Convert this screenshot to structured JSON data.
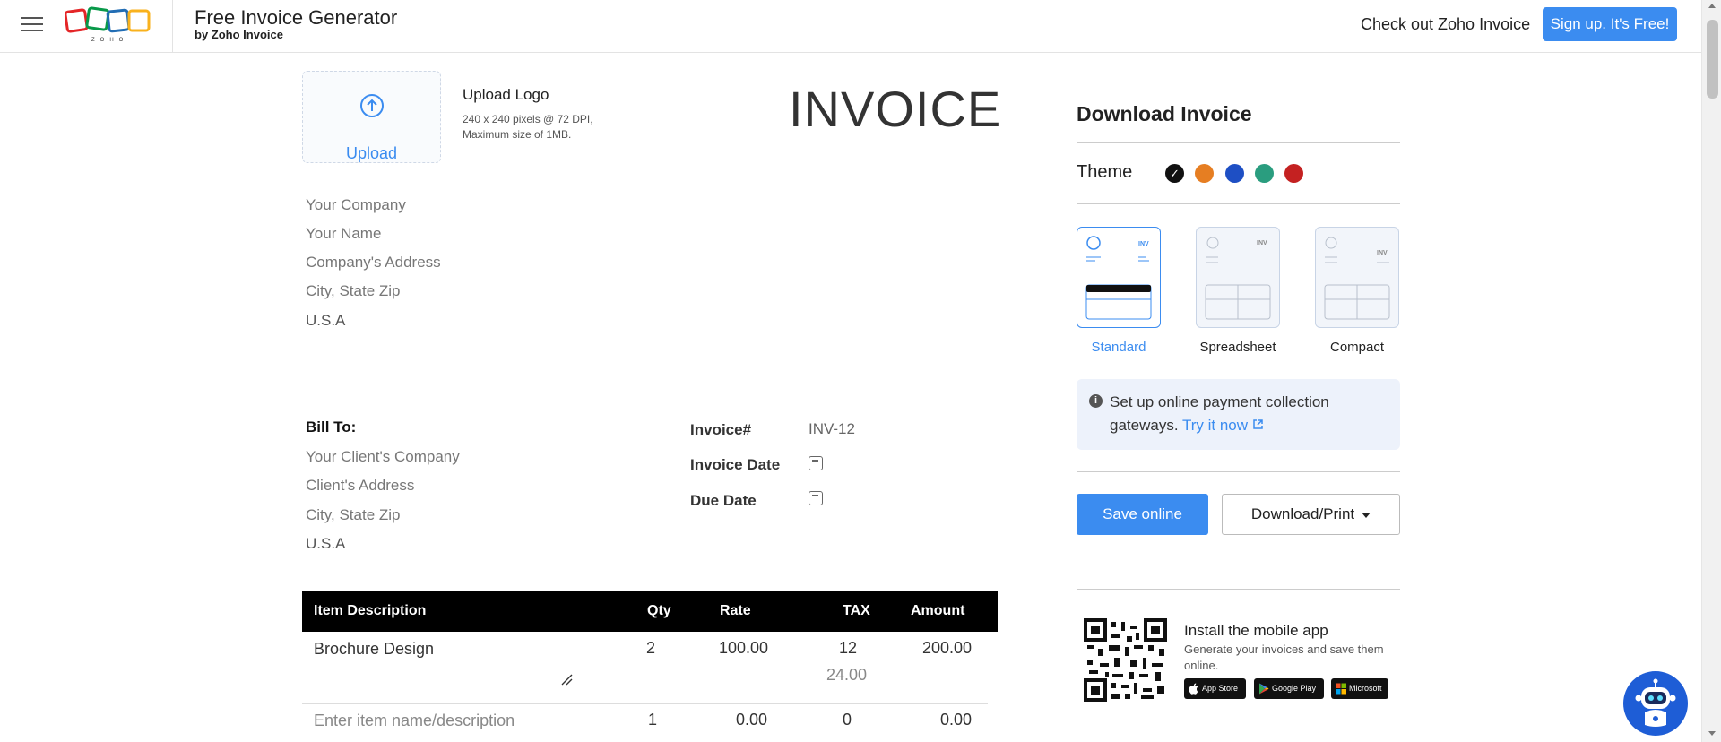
{
  "header": {
    "title": "Free Invoice Generator",
    "subtitle": "by Zoho Invoice",
    "cta_text": "Check out Zoho Invoice",
    "signup_label": "Sign up. It's Free!",
    "logo_text": "ZOHO"
  },
  "invoice": {
    "upload_label": "Upload",
    "upload_title": "Upload Logo",
    "upload_hint_1": "240 x 240 pixels @ 72 DPI,",
    "upload_hint_2": "Maximum size of 1MB.",
    "heading": "INVOICE",
    "company": {
      "name": "Your Company",
      "person": "Your Name",
      "address": "Company's Address",
      "city": "City, State Zip",
      "country": "U.S.A"
    },
    "bill_to_label": "Bill To:",
    "client": {
      "name": "Your Client's Company",
      "address": "Client's Address",
      "city": "City, State Zip",
      "country": "U.S.A"
    },
    "meta": {
      "number_label": "Invoice#",
      "number_value": "INV-12",
      "date_label": "Invoice Date",
      "due_label": "Due Date"
    },
    "table": {
      "headers": [
        "Item Description",
        "Qty",
        "Rate",
        "TAX",
        "Amount"
      ],
      "rows": [
        {
          "desc": "Brochure Design",
          "qty": "2",
          "rate": "100.00",
          "tax": "12",
          "tax_amount": "24.00",
          "amount": "200.00"
        },
        {
          "desc": "Enter item name/description",
          "qty": "1",
          "rate": "0.00",
          "tax": "0",
          "amount": "0.00"
        }
      ]
    }
  },
  "sidebar": {
    "title": "Download Invoice",
    "theme_label": "Theme",
    "themes": [
      "#111111",
      "#e67e22",
      "#1e4fc4",
      "#2a9d7f",
      "#c42121"
    ],
    "templates": [
      {
        "label": "Standard",
        "active": true
      },
      {
        "label": "Spreadsheet",
        "active": false
      },
      {
        "label": "Compact",
        "active": false
      }
    ],
    "template_thumb_text": "INV",
    "payment_text": "Set up online payment collection gateways.",
    "payment_link": "Try it now",
    "save_label": "Save online",
    "download_label": "Download/Print",
    "app_title": "Install the mobile app",
    "app_desc": "Generate your invoices and save them online.",
    "stores": [
      "App Store",
      "Google Play",
      "Microsoft"
    ]
  },
  "colors": {
    "accent": "#3b8cf0",
    "table_header": "#000000",
    "payment_box": "#edf2fb"
  }
}
